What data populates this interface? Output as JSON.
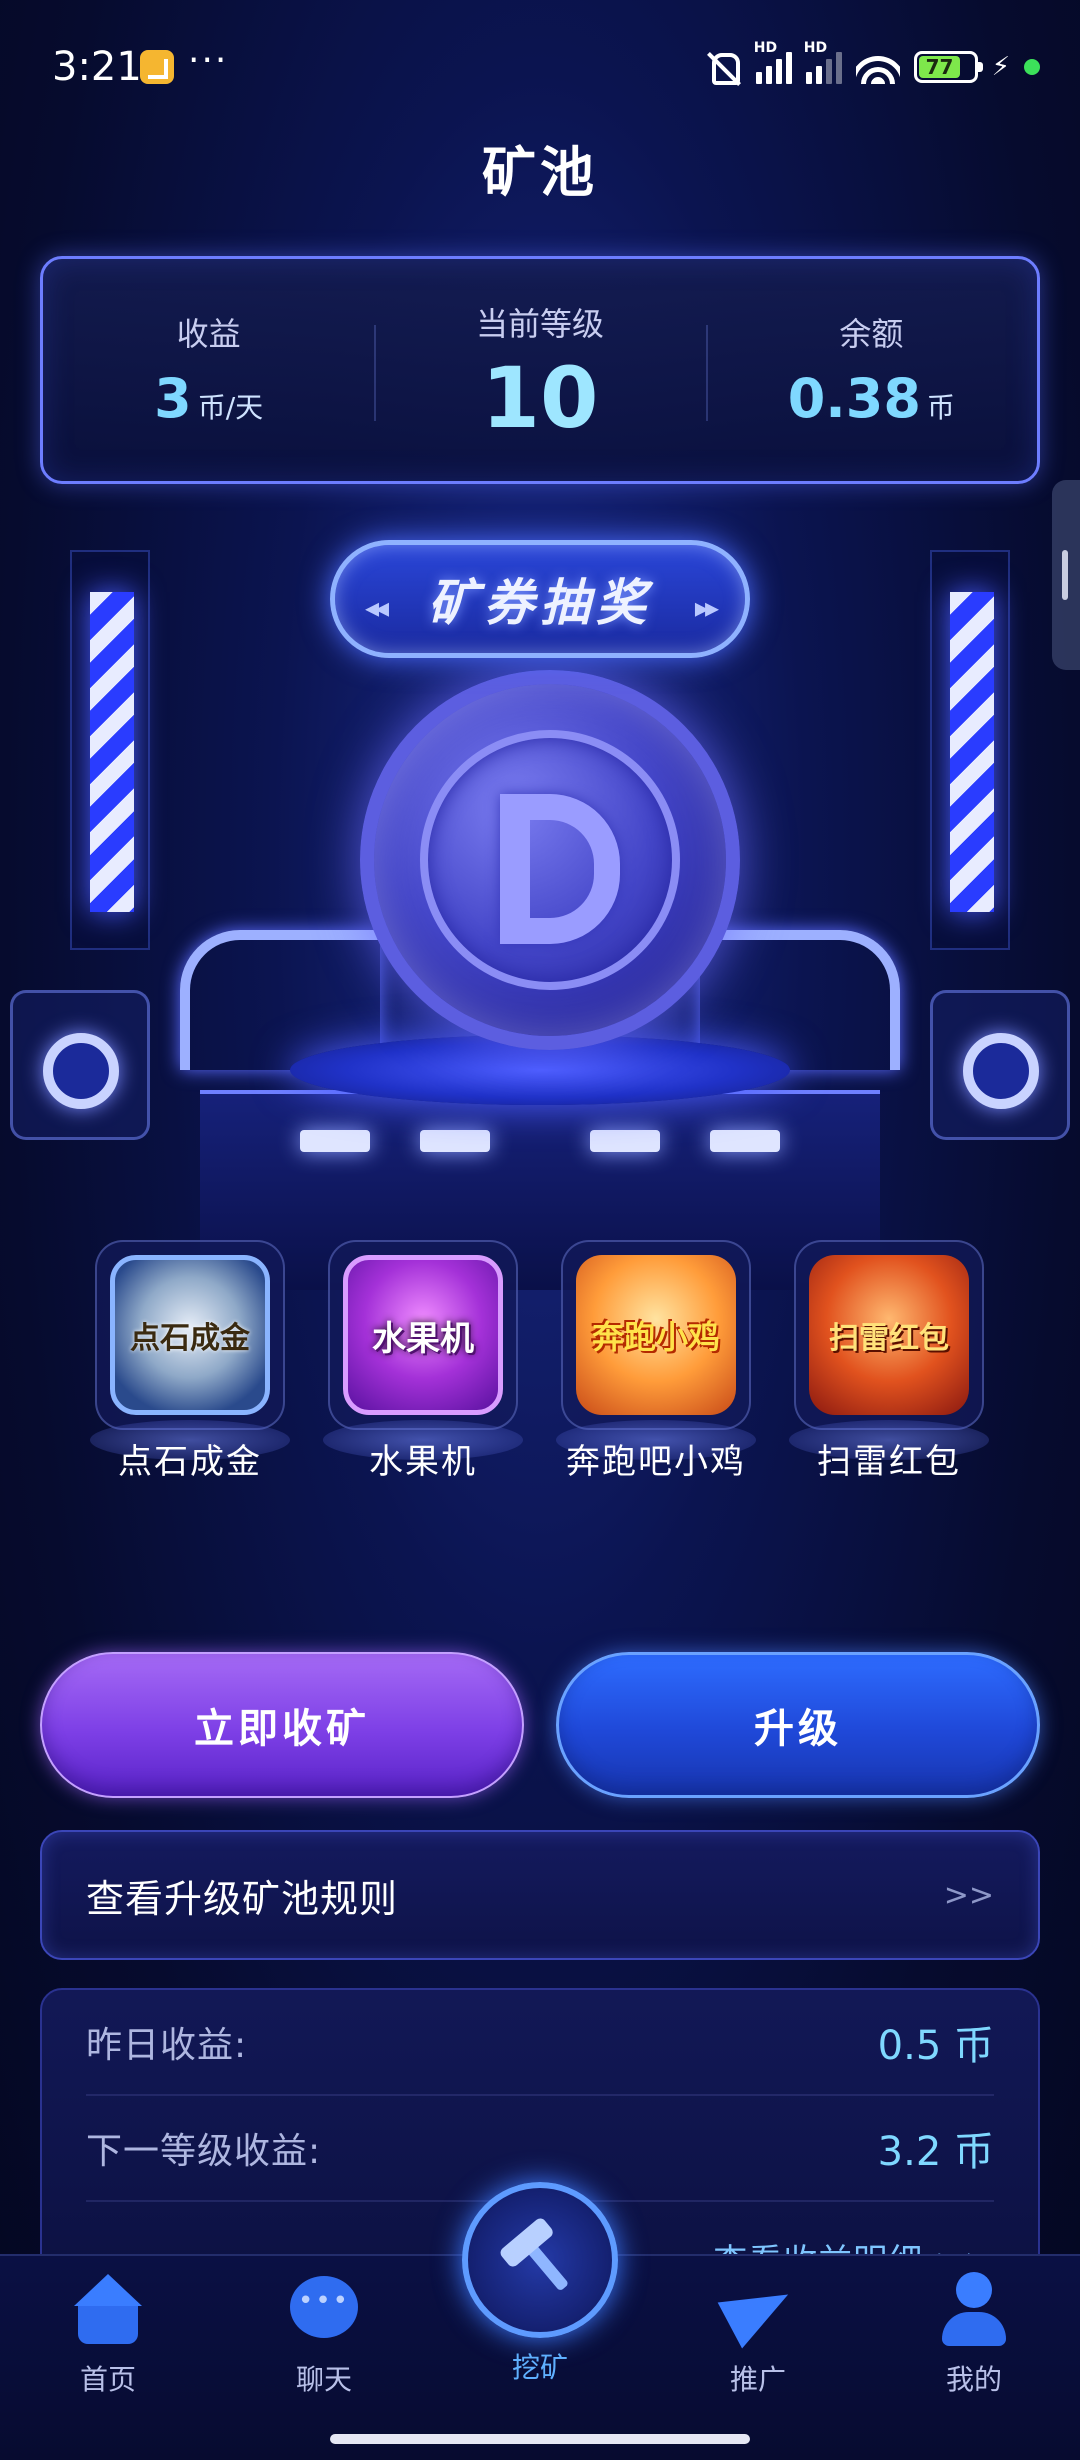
{
  "status_bar": {
    "time": "3:21",
    "more": "···",
    "network_badges": [
      "HD",
      "HD"
    ],
    "battery_level": 77,
    "battery_text": "77",
    "icons": [
      "note-icon",
      "mute-icon",
      "signal-icon",
      "wifi-icon",
      "battery-icon",
      "charging-icon"
    ]
  },
  "header": {
    "title": "矿池"
  },
  "stats": {
    "income": {
      "label": "收益",
      "value": "3",
      "unit": "币/天"
    },
    "level": {
      "label": "当前等级",
      "value": "10"
    },
    "balance": {
      "label": "余额",
      "value": "0.38",
      "unit": "币"
    }
  },
  "scene": {
    "lottery_label": "矿券抽奖"
  },
  "games": [
    {
      "label": "点石成金",
      "icon_text": "点石成金",
      "icon": "gold-stone-game-icon"
    },
    {
      "label": "水果机",
      "icon_text": "水果机",
      "icon": "fruit-machine-game-icon"
    },
    {
      "label": "奔跑吧小鸡",
      "icon_text": "奔跑小鸡",
      "icon": "running-chick-game-icon"
    },
    {
      "label": "扫雷红包",
      "icon_text": "扫雷红包",
      "icon": "minesweeper-red-packet-game-icon"
    }
  ],
  "actions": {
    "collect_label": "立即收矿",
    "upgrade_label": "升级"
  },
  "rules": {
    "label": "查看升级矿池规则",
    "arrow": ">>"
  },
  "earnings": {
    "yesterday_label": "昨日收益:",
    "yesterday_value": "0.5 币",
    "next_level_label": "下一等级收益:",
    "next_level_value": "3.2 币",
    "details_link": "查看收益明细 >>"
  },
  "bottom_nav": {
    "items": [
      {
        "label": "首页",
        "icon": "home-icon"
      },
      {
        "label": "聊天",
        "icon": "chat-icon"
      },
      {
        "label": "挖矿",
        "icon": "hammer-icon",
        "active": true
      },
      {
        "label": "推广",
        "icon": "paper-plane-icon"
      },
      {
        "label": "我的",
        "icon": "user-icon"
      }
    ]
  },
  "colors": {
    "accent_cyan": "#7fd8ff",
    "purple_button": "#7d3fe6",
    "blue_button": "#1f48d8",
    "background": "#060b2e"
  }
}
